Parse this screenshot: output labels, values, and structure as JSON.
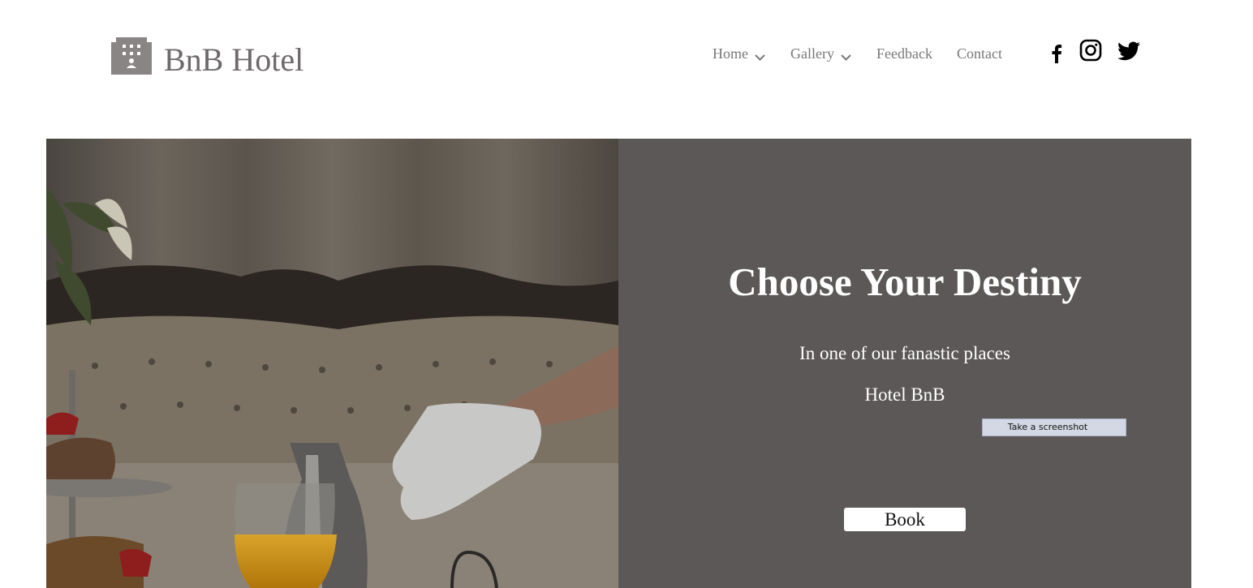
{
  "brand": {
    "name": "BnB Hotel",
    "icon": "hotel-building-icon"
  },
  "nav": {
    "items": [
      {
        "label": "Home",
        "has_dropdown": true
      },
      {
        "label": "Gallery",
        "has_dropdown": true
      },
      {
        "label": "Feedback",
        "has_dropdown": false
      },
      {
        "label": "Contact",
        "has_dropdown": false
      }
    ]
  },
  "social": [
    {
      "icon": "facebook-icon"
    },
    {
      "icon": "instagram-icon"
    },
    {
      "icon": "twitter-icon"
    }
  ],
  "hero": {
    "image": "breakfast-room-service-photo",
    "headline": "Choose Your Destiny",
    "subline": "In one of our fanastic places",
    "subline2": "Hotel BnB",
    "screenshot_button": "Take a screenshot",
    "book_button": "Book"
  },
  "colors": {
    "panel": "#5d5858",
    "text_gray": "#7a7777",
    "logo_gray": "#6e6a6a",
    "white": "#ffffff"
  }
}
